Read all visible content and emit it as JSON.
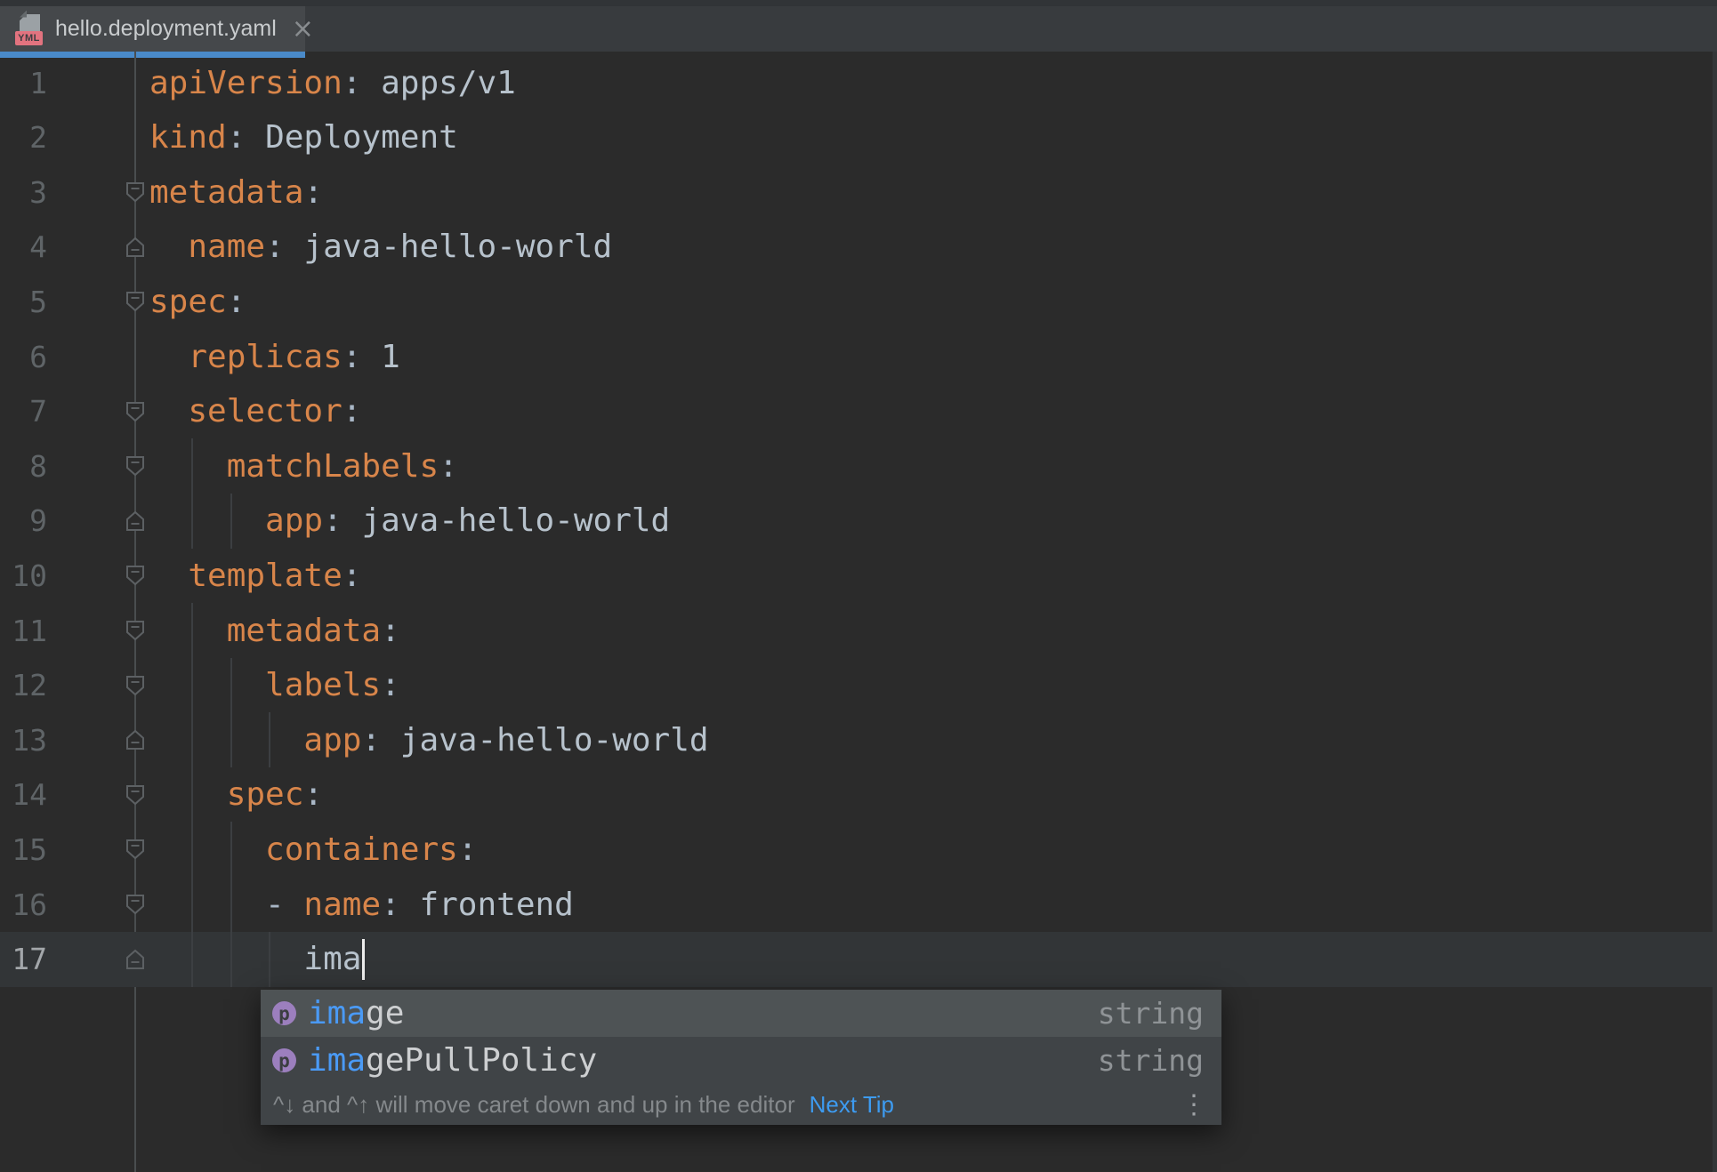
{
  "tab": {
    "title": "hello.deployment.yaml",
    "file_type_badge": "YML",
    "close_glyph": "×"
  },
  "editor": {
    "lines": [
      {
        "num": "1",
        "indent": 0,
        "fold": "none",
        "tokens": [
          {
            "t": "apiVersion",
            "c": "key"
          },
          {
            "t": ": ",
            "c": "punc"
          },
          {
            "t": "apps/v1",
            "c": "val"
          }
        ]
      },
      {
        "num": "2",
        "indent": 0,
        "fold": "none",
        "tokens": [
          {
            "t": "kind",
            "c": "key"
          },
          {
            "t": ": ",
            "c": "punc"
          },
          {
            "t": "Deployment",
            "c": "val"
          }
        ]
      },
      {
        "num": "3",
        "indent": 0,
        "fold": "start",
        "tokens": [
          {
            "t": "metadata",
            "c": "key"
          },
          {
            "t": ":",
            "c": "punc"
          }
        ]
      },
      {
        "num": "4",
        "indent": 2,
        "fold": "end",
        "tokens": [
          {
            "t": "  ",
            "c": "punc"
          },
          {
            "t": "name",
            "c": "key"
          },
          {
            "t": ": ",
            "c": "punc"
          },
          {
            "t": "java-hello-world",
            "c": "val"
          }
        ]
      },
      {
        "num": "5",
        "indent": 0,
        "fold": "start",
        "tokens": [
          {
            "t": "spec",
            "c": "key"
          },
          {
            "t": ":",
            "c": "punc"
          }
        ]
      },
      {
        "num": "6",
        "indent": 2,
        "fold": "none",
        "tokens": [
          {
            "t": "  ",
            "c": "punc"
          },
          {
            "t": "replicas",
            "c": "key"
          },
          {
            "t": ": ",
            "c": "punc"
          },
          {
            "t": "1",
            "c": "val"
          }
        ]
      },
      {
        "num": "7",
        "indent": 2,
        "fold": "start",
        "tokens": [
          {
            "t": "  ",
            "c": "punc"
          },
          {
            "t": "selector",
            "c": "key"
          },
          {
            "t": ":",
            "c": "punc"
          }
        ]
      },
      {
        "num": "8",
        "indent": 4,
        "fold": "start",
        "tokens": [
          {
            "t": "    ",
            "c": "punc"
          },
          {
            "t": "matchLabels",
            "c": "key"
          },
          {
            "t": ":",
            "c": "punc"
          }
        ]
      },
      {
        "num": "9",
        "indent": 6,
        "fold": "end",
        "tokens": [
          {
            "t": "      ",
            "c": "punc"
          },
          {
            "t": "app",
            "c": "key"
          },
          {
            "t": ": ",
            "c": "punc"
          },
          {
            "t": "java-hello-world",
            "c": "val"
          }
        ]
      },
      {
        "num": "10",
        "indent": 2,
        "fold": "start",
        "tokens": [
          {
            "t": "  ",
            "c": "punc"
          },
          {
            "t": "template",
            "c": "key"
          },
          {
            "t": ":",
            "c": "punc"
          }
        ]
      },
      {
        "num": "11",
        "indent": 4,
        "fold": "start",
        "tokens": [
          {
            "t": "    ",
            "c": "punc"
          },
          {
            "t": "metadata",
            "c": "key"
          },
          {
            "t": ":",
            "c": "punc"
          }
        ]
      },
      {
        "num": "12",
        "indent": 6,
        "fold": "start",
        "tokens": [
          {
            "t": "      ",
            "c": "punc"
          },
          {
            "t": "labels",
            "c": "key"
          },
          {
            "t": ":",
            "c": "punc"
          }
        ]
      },
      {
        "num": "13",
        "indent": 8,
        "fold": "end",
        "tokens": [
          {
            "t": "        ",
            "c": "punc"
          },
          {
            "t": "app",
            "c": "key"
          },
          {
            "t": ": ",
            "c": "punc"
          },
          {
            "t": "java-hello-world",
            "c": "val"
          }
        ]
      },
      {
        "num": "14",
        "indent": 4,
        "fold": "start",
        "tokens": [
          {
            "t": "    ",
            "c": "punc"
          },
          {
            "t": "spec",
            "c": "key"
          },
          {
            "t": ":",
            "c": "punc"
          }
        ]
      },
      {
        "num": "15",
        "indent": 6,
        "fold": "start",
        "tokens": [
          {
            "t": "      ",
            "c": "punc"
          },
          {
            "t": "containers",
            "c": "key"
          },
          {
            "t": ":",
            "c": "punc"
          }
        ]
      },
      {
        "num": "16",
        "indent": 6,
        "fold": "start",
        "tokens": [
          {
            "t": "      - ",
            "c": "punc"
          },
          {
            "t": "name",
            "c": "key"
          },
          {
            "t": ": ",
            "c": "punc"
          },
          {
            "t": "frontend",
            "c": "val"
          }
        ]
      },
      {
        "num": "17",
        "indent": 8,
        "fold": "end",
        "current": true,
        "caret": true,
        "tokens": [
          {
            "t": "        ",
            "c": "punc"
          },
          {
            "t": "ima",
            "c": "val"
          }
        ]
      }
    ]
  },
  "completion": {
    "items": [
      {
        "icon": "p",
        "prefix": "ima",
        "rest": "ge",
        "type": "string",
        "selected": true
      },
      {
        "icon": "p",
        "prefix": "ima",
        "rest": "gePullPolicy",
        "type": "string",
        "selected": false
      }
    ],
    "hint": "^↓ and ^↑ will move caret down and up in the editor",
    "link_label": "Next Tip",
    "more_glyph": "⋮"
  },
  "colors": {
    "bg": "#2B2B2B",
    "strip_bg": "#313437",
    "bar_bg": "#383B3E",
    "tab_bg": "#45484B",
    "accent": "#4A8AC9",
    "tab_title": "#C9CCCE",
    "close": "#888C8F",
    "gutter_line": "#4A4D4F",
    "line_band": "#323537",
    "key": "#D8854A",
    "punc": "#A9B7C6",
    "val": "#B7C2CC",
    "lnum": "#5F6467",
    "lnum_cur": "#A3A7AA",
    "guide": "#3C3F42",
    "fold_stroke": "#5C6063",
    "caret": "#ECECEC",
    "scroll": "#343638",
    "popup_bg": "#404447",
    "popup_sel": "#4E5355",
    "popup_text": "#CDCFD1",
    "popup_prefix": "#4A9AF5",
    "popup_type": "#8F9396",
    "hint_text": "#85898C",
    "link": "#3D9BF0",
    "icon_bg": "#9C7FBE",
    "icon_fg": "#3B3E41"
  }
}
